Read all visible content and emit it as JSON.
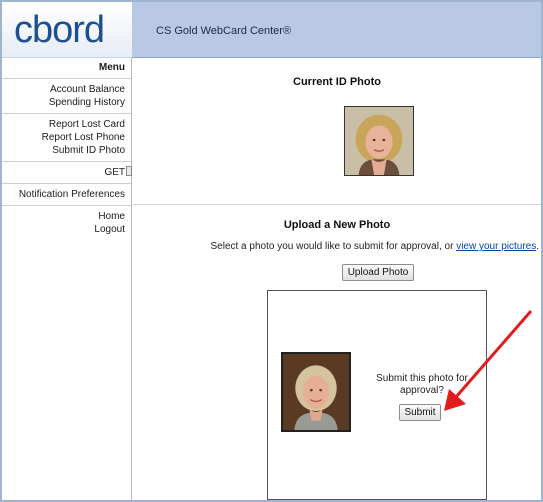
{
  "app": {
    "logo": "cbord",
    "title": "CS Gold WebCard Center®"
  },
  "sidebar": {
    "heading": "Menu",
    "groups": [
      {
        "items": [
          "Account Balance",
          "Spending History"
        ]
      },
      {
        "items": [
          "Report Lost Card",
          "Report Lost Phone",
          "Submit ID Photo"
        ]
      },
      {
        "items": [
          "GET"
        ]
      },
      {
        "items": [
          "Notification Preferences"
        ]
      },
      {
        "items": [
          "Home",
          "Logout"
        ]
      }
    ]
  },
  "current_photo": {
    "heading": "Current ID Photo"
  },
  "upload": {
    "heading": "Upload a New Photo",
    "instruction": "Select a photo you would like to submit for approval, or ",
    "link": "view your pictures",
    "instruction_end": ".",
    "button": "Upload Photo"
  },
  "preview": {
    "question": "Submit this photo for approval?",
    "submit_button": "Submit"
  },
  "colors": {
    "brand": "#1d4f91",
    "banner": "#b9c8e4",
    "arrow": "#e21b1b",
    "link": "#0645ad"
  }
}
